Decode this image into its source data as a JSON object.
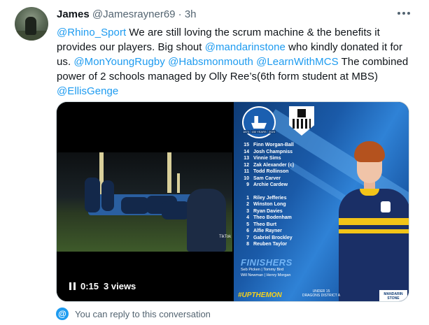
{
  "tweet": {
    "author_name": "James",
    "author_handle": "@Jamesrayner69",
    "separator": "·",
    "time": "3h",
    "body": [
      {
        "type": "mention",
        "text": "@Rhino_Sport"
      },
      {
        "type": "text",
        "text": " We are still loving the scrum machine & the benefits it provides our players. Big shout "
      },
      {
        "type": "mention",
        "text": "@mandarinstone"
      },
      {
        "type": "text",
        "text": " who kindly donated it for us. "
      },
      {
        "type": "mention",
        "text": "@MonYoungRugby"
      },
      {
        "type": "text",
        "text": " "
      },
      {
        "type": "mention",
        "text": "@Habsmonmouth"
      },
      {
        "type": "text",
        "text": " "
      },
      {
        "type": "mention",
        "text": "@LearnWithMCS"
      },
      {
        "type": "text",
        "text": " The combined power of 2 schools managed by Olly Ree’s(6th form student at MBS) "
      },
      {
        "type": "mention",
        "text": "@EllisGenge"
      }
    ]
  },
  "video": {
    "elapsed": "0:15",
    "views": "3 views",
    "watermark": "TikTok"
  },
  "lineup_graphic": {
    "crest_years": [
      "1873",
      "150 YEARS",
      "2023"
    ],
    "starters": [
      {
        "num": "15",
        "name": "Finn Worgan-Ball"
      },
      {
        "num": "14",
        "name": "Josh Champniss"
      },
      {
        "num": "13",
        "name": "Vinnie Sims"
      },
      {
        "num": "12",
        "name": "Zak Alexander (c)"
      },
      {
        "num": "11",
        "name": "Todd Rollinson"
      },
      {
        "num": "10",
        "name": "Sam Carver"
      },
      {
        "num": "9",
        "name": "Archie Cardew"
      }
    ],
    "forwards": [
      {
        "num": "1",
        "name": "Riley Jefferies"
      },
      {
        "num": "2",
        "name": "Winston Long"
      },
      {
        "num": "3",
        "name": "Ryan Davies"
      },
      {
        "num": "4",
        "name": "Theo Bodenham"
      },
      {
        "num": "5",
        "name": "Theo Burt"
      },
      {
        "num": "6",
        "name": "Alfie Rayner"
      },
      {
        "num": "7",
        "name": "Gabriel Brockley"
      },
      {
        "num": "8",
        "name": "Reuben Taylor"
      }
    ],
    "finishers_title": "FINISHERS",
    "finishers_row1": "Seb Picken | Tommy Bird",
    "finishers_row2": "Will Newman | Henry Morgan",
    "hashtag": "#UPTHEMON",
    "competition_line1": "UNDER 15",
    "competition_line2": "DRAGONS DISTRICT A",
    "sponsor": "MANDARIN STONE"
  },
  "reply_bar": {
    "icon": "at-icon",
    "text": "You can reply to this conversation"
  },
  "colors": {
    "link": "#1d9bf0",
    "secondary_text": "#536471",
    "graphic_blue": "#1a5aa8",
    "kit_gold": "#f2c418"
  }
}
